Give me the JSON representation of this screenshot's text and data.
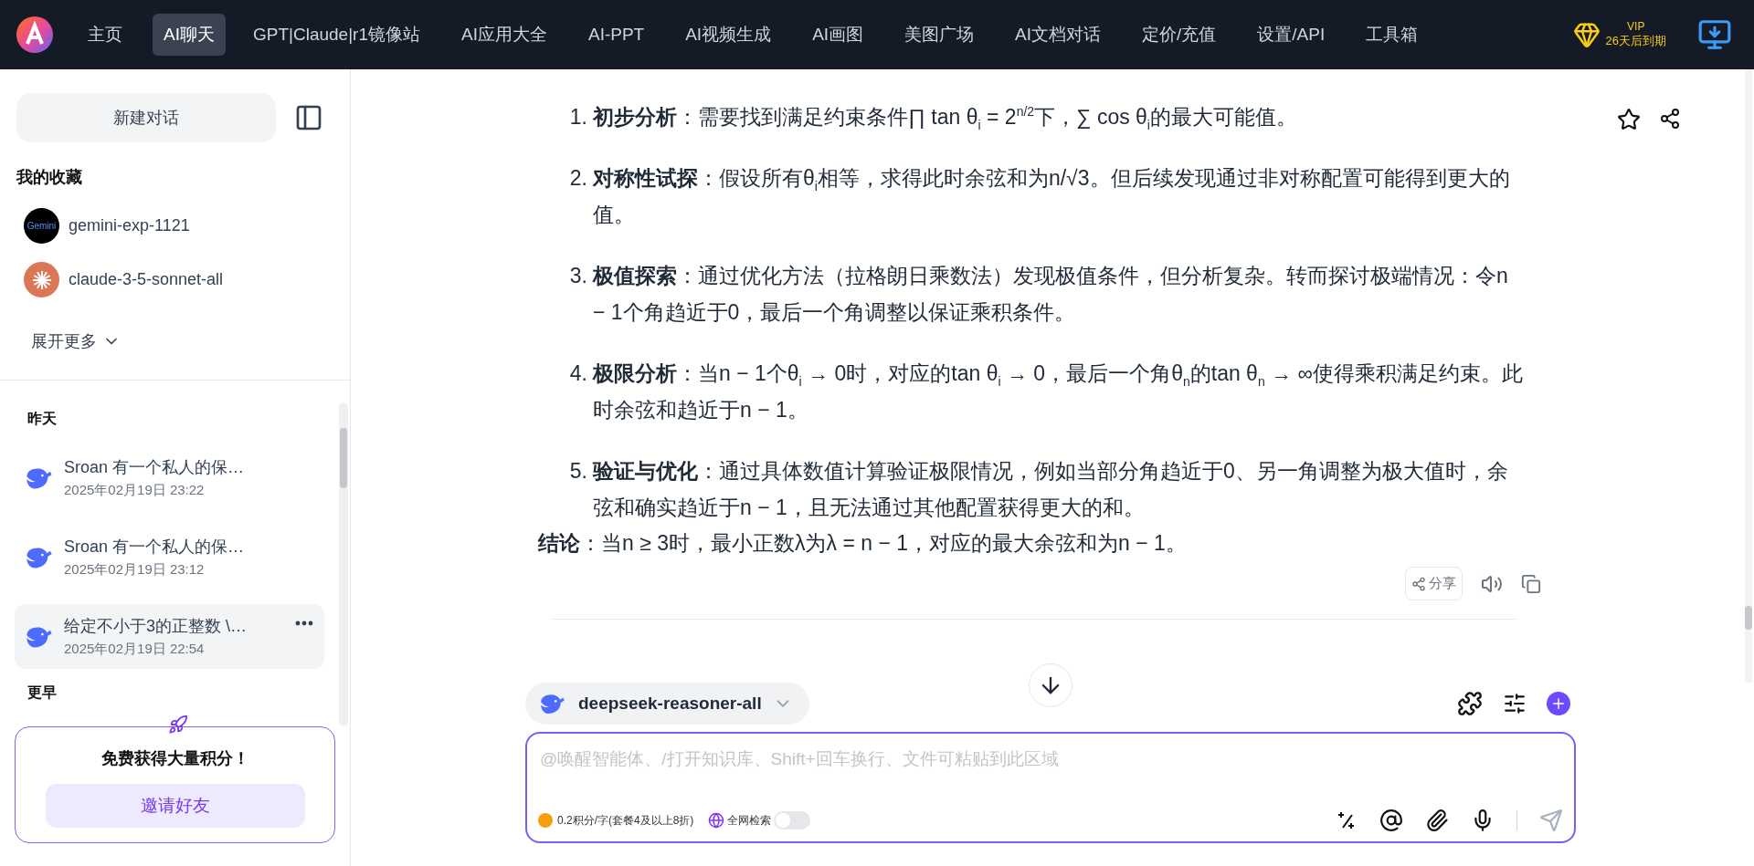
{
  "nav": {
    "items": [
      {
        "label": "主页",
        "selected": false
      },
      {
        "label": "AI聊天",
        "selected": true
      },
      {
        "label": "GPT|Claude|r1镜像站",
        "selected": false
      },
      {
        "label": "AI应用大全",
        "selected": false
      },
      {
        "label": "AI-PPT",
        "selected": false
      },
      {
        "label": "AI视频生成",
        "selected": false
      },
      {
        "label": "AI画图",
        "selected": false
      },
      {
        "label": "美图广场",
        "selected": false
      },
      {
        "label": "AI文档对话",
        "selected": false
      },
      {
        "label": "定价/充值",
        "selected": false
      },
      {
        "label": "设置/API",
        "selected": false
      },
      {
        "label": "工具箱",
        "selected": false
      }
    ],
    "vip": {
      "badge": "VIP",
      "text": "26天后到期"
    }
  },
  "sidebar": {
    "new_chat": "新建对话",
    "favorites_title": "我的收藏",
    "favorites": [
      {
        "kind": "gemini",
        "name": "gemini-exp-1121",
        "logo_text": "Gemini"
      },
      {
        "kind": "claude",
        "name": "claude-3-5-sonnet-all"
      }
    ],
    "expand": "展开更多",
    "groups": [
      {
        "title": "昨天",
        "items": [
          {
            "title": "Sroan 有一个私人的保…",
            "time": "2025年02月19日 23:22",
            "selected": false
          },
          {
            "title": "Sroan 有一个私人的保…",
            "time": "2025年02月19日 23:12",
            "selected": false
          },
          {
            "title": "给定不小于3的正整数 \\…",
            "time": "2025年02月19日 22:54",
            "selected": true
          }
        ]
      },
      {
        "title": "更早"
      }
    ],
    "promo": {
      "title": "免费获得大量积分！",
      "button": "邀请好友"
    }
  },
  "message": {
    "items": [
      {
        "number": "1.",
        "text": "**初步分析**：需要找到满足约束条件∏ tan θ$_{i}$ = 2$^{n/2}$下，∑ cos θ$_{i}$的最大可能值。"
      },
      {
        "number": "2.",
        "text": "**对称性试探**：假设所有θ$_{i}$相等，求得此时余弦和为n/√3。但后续发现通过非对称配置可能得到更大的值。"
      },
      {
        "number": "3.",
        "text": "**极值探索**：通过优化方法（拉格朗日乘数法）发现极值条件，但分析复杂。转而探讨极端情况：令n − 1个角趋近于0，最后一个角调整以保证乘积条件。"
      },
      {
        "number": "4.",
        "text": "**极限分析**：当n − 1个θ$_{i}$ → 0时，对应的tan θ$_{i}$ → 0，最后一个角θ$_{n}$的tan θ$_{n}$ → ∞使得乘积满足约束。此时余弦和趋近于n − 1。"
      },
      {
        "number": "5.",
        "text": "**验证与优化**：通过具体数值计算验证极限情况，例如当部分角趋近于0、另一角调整为极大值时，余弦和确实趋近于n − 1，且无法通过其他配置获得更大的和。"
      }
    ],
    "conclusion": "**结论**：当n ≥ 3时，最小正数λ为λ = n − 1，对应的最大余弦和为n − 1。",
    "share": "分享"
  },
  "composer": {
    "model": "deepseek-reasoner-all",
    "placeholder": "@唤醒智能体、/打开知识库、Shift+回车换行、文件可粘贴到此区域",
    "cost": "0.2积分/字(套餐4及以上8折)",
    "web_search": {
      "label": "全网检索",
      "on": false
    }
  }
}
